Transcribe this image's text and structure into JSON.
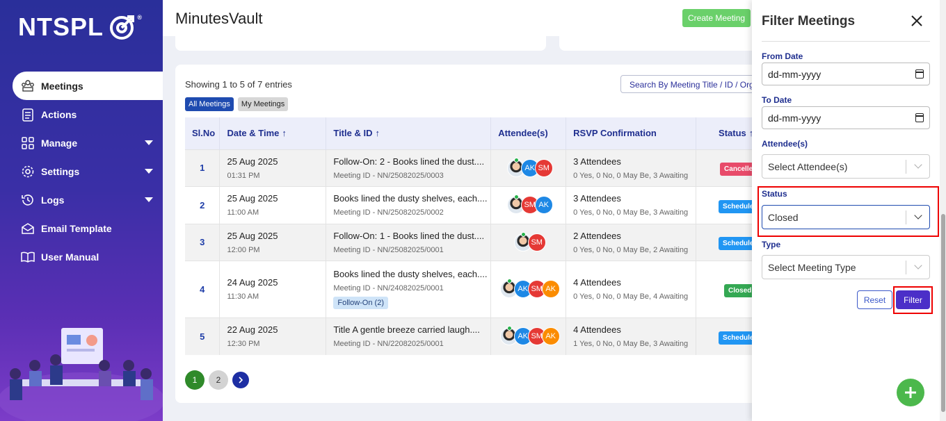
{
  "brand": {
    "name": "NTSPL",
    "reg": "®"
  },
  "sidebar": {
    "items": [
      {
        "label": "Meetings",
        "icon": "meetings-icon",
        "active": true
      },
      {
        "label": "Actions",
        "icon": "actions-icon"
      },
      {
        "label": "Manage",
        "icon": "manage-icon",
        "caret": true
      },
      {
        "label": "Settings",
        "icon": "settings-icon",
        "caret": true
      },
      {
        "label": "Logs",
        "icon": "logs-icon",
        "caret": true
      },
      {
        "label": "Email Template",
        "icon": "email-icon"
      },
      {
        "label": "User Manual",
        "icon": "manual-icon"
      }
    ]
  },
  "header": {
    "title": "MinutesVault",
    "create_label": "Create Meeting"
  },
  "list": {
    "entries_text": "Showing 1 to 5 of 7 entries",
    "search_placeholder": "Search By Meeting Title / ID / Orga",
    "tabs": {
      "all": "All Meetings",
      "mine": "My Meetings"
    },
    "columns": {
      "sl": "Sl.No",
      "date": "Date & Time",
      "title": "Title & ID",
      "attendees": "Attendee(s)",
      "rsvp": "RSVP Confirmation",
      "status": "Status"
    },
    "rows": [
      {
        "sl": "1",
        "date": "25 Aug 2025",
        "time": "01:31 PM",
        "title": "Follow-On: 2 - Books lined the dust....",
        "mid": "Meeting ID - NN/25082025/0003",
        "rsvp": "3 Attendees",
        "rsvp_detail": "0 Yes, 0 No, 0 May Be, 3 Awaiting",
        "status": "Cancelle"
      },
      {
        "sl": "2",
        "date": "25 Aug 2025",
        "time": "11:00 AM",
        "title": "Books lined the dusty shelves, each....",
        "mid": "Meeting ID - NN/25082025/0002",
        "rsvp": "3 Attendees",
        "rsvp_detail": "0 Yes, 0 No, 0 May Be, 3 Awaiting",
        "status": "Schedule"
      },
      {
        "sl": "3",
        "date": "25 Aug 2025",
        "time": "12:00 PM",
        "title": "Follow-On: 1 - Books lined the dust....",
        "mid": "Meeting ID - NN/25082025/0001",
        "rsvp": "2 Attendees",
        "rsvp_detail": "0 Yes, 0 No, 0 May Be, 2 Awaiting",
        "status": "Schedule"
      },
      {
        "sl": "4",
        "date": "24 Aug 2025",
        "time": "11:30 AM",
        "title": "Books lined the dusty shelves, each....",
        "mid": "Meeting ID - NN/24082025/0001",
        "chip": "Follow-On (2)",
        "rsvp": "4 Attendees",
        "rsvp_detail": "0 Yes, 0 No, 0 May Be, 4 Awaiting",
        "status": "Closed"
      },
      {
        "sl": "5",
        "date": "22 Aug 2025",
        "time": "12:30 PM",
        "title": "Title A gentle breeze carried laugh....",
        "mid": "Meeting ID - NN/22082025/0001",
        "rsvp": "4 Attendees",
        "rsvp_detail": "1 Yes, 0 No, 0 May Be, 3 Awaiting",
        "status": "Schedule"
      }
    ],
    "avatar_initials": {
      "ak": "AK",
      "sm": "SM"
    },
    "pages": [
      "1",
      "2"
    ]
  },
  "filter": {
    "title": "Filter Meetings",
    "from_label": "From Date",
    "from_value": "dd-mm-yyyy",
    "to_label": "To Date",
    "to_value": "dd-mm-yyyy",
    "attendee_label": "Attendee(s)",
    "attendee_placeholder": "Select Attendee(s)",
    "status_label": "Status",
    "status_value": "Closed",
    "type_label": "Type",
    "type_placeholder": "Select Meeting Type",
    "reset_label": "Reset",
    "filter_label": "Filter"
  },
  "colors": {
    "accent": "#2a2f9a",
    "filter_button": "#4b2fc8",
    "highlight": "#e00000"
  }
}
